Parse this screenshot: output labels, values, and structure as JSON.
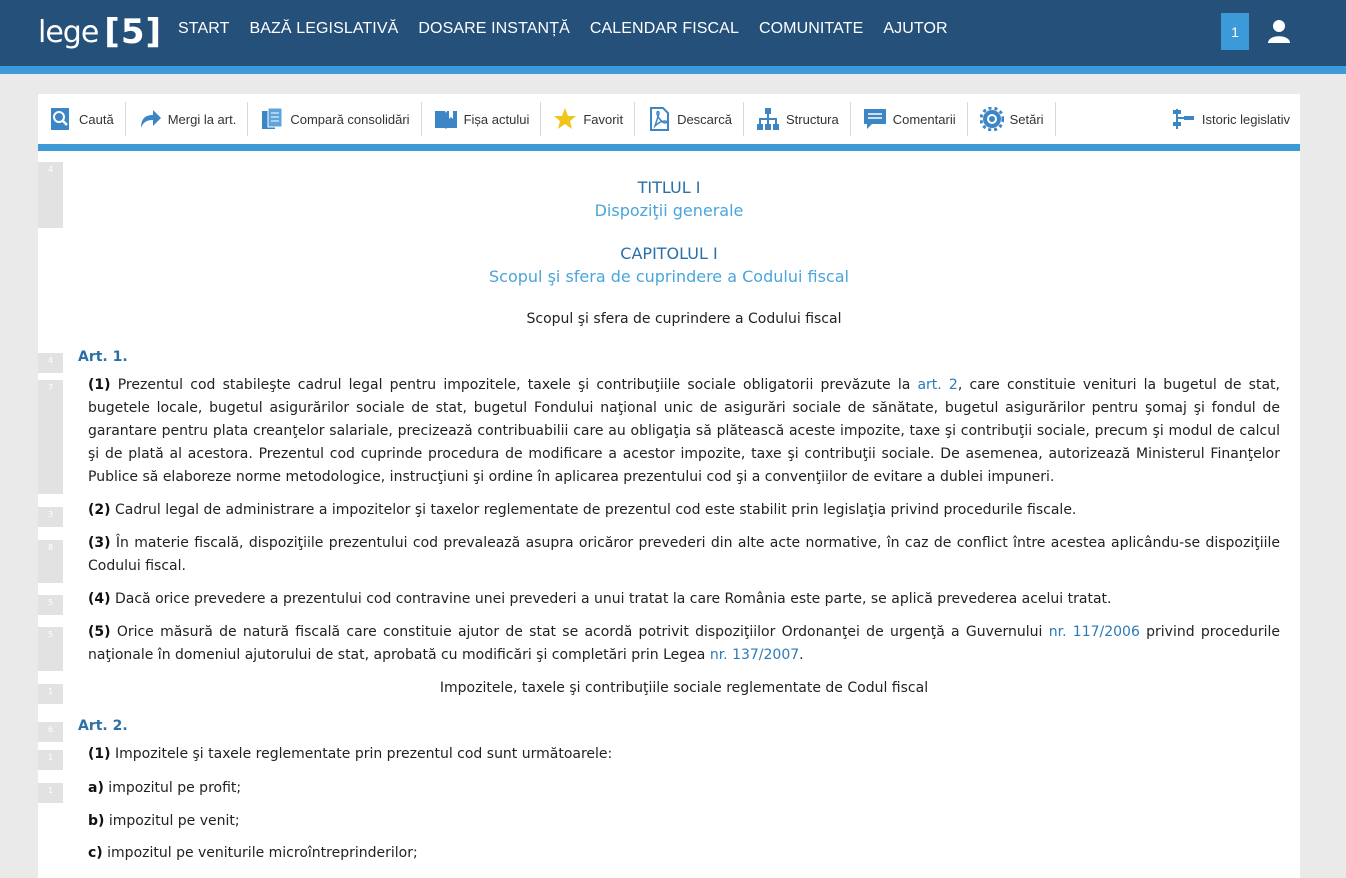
{
  "logo": {
    "word": "lege",
    "number": "[5]"
  },
  "nav": [
    "START",
    "BAZĂ LEGISLATIVĂ",
    "DOSARE INSTANȚĂ",
    "CALENDAR FISCAL",
    "COMUNITATE",
    "AJUTOR"
  ],
  "badge": "1",
  "toolbar": {
    "search": "Caută",
    "goto": "Mergi la art.",
    "compare": "Compară consolidări",
    "sheet": "Fișa actului",
    "favorite": "Favorit",
    "download": "Descarcă",
    "structure": "Structura",
    "comments": "Comentarii",
    "settings": "Setări",
    "history": "Istoric legislativ"
  },
  "doc": {
    "title1": "TITLUL I",
    "title1_sub": "Dispoziţii generale",
    "chapter1": "CAPITOLUL I",
    "chapter1_sub": "Scopul şi sfera de cuprindere a Codului fiscal",
    "marginal1": "Scopul şi sfera de cuprindere a Codului fiscal",
    "art1": "Art. 1.",
    "p1_num": "(1)",
    "p1_a": " Prezentul cod stabileşte cadrul legal pentru impozitele, taxele şi contribuţiile sociale obligatorii prevăzute la ",
    "p1_link": "art. 2",
    "p1_b": ", care constituie venituri la bugetul de stat, bugetele locale, bugetul asigurărilor sociale de stat, bugetul Fondului naţional unic de asigurări sociale de sănătate, bugetul asigurărilor pentru şomaj şi fondul de garantare pentru plata creanţelor salariale, precizează contribuabilii care au obligaţia să plătească aceste impozite, taxe şi contribuţii sociale, precum şi modul de calcul şi de plată al acestora. Prezentul cod cuprinde procedura de modificare a acestor impozite, taxe şi contribuţii sociale. De asemenea, autorizează Ministerul Finanţelor Publice să elaboreze norme metodologice, instrucţiuni şi ordine în aplicarea prezentului cod şi a convenţiilor de evitare a dublei impuneri.",
    "p2_num": "(2)",
    "p2": " Cadrul legal de administrare a impozitelor şi taxelor reglementate de prezentul cod este stabilit prin legislaţia privind procedurile fiscale.",
    "p3_num": "(3)",
    "p3": " În materie fiscală, dispoziţiile prezentului cod prevalează asupra oricăror prevederi din alte acte normative, în caz de conflict între acestea aplicându-se dispoziţiile Codului fiscal.",
    "p4_num": "(4)",
    "p4": " Dacă orice prevedere a prezentului cod contravine unei prevederi a unui tratat la care România este parte, se aplică prevederea acelui tratat.",
    "p5_num": "(5)",
    "p5_a": " Orice măsură de natură fiscală care constituie ajutor de stat se acordă potrivit dispoziţiilor Ordonanţei de urgenţă a Guvernului ",
    "p5_link1": "nr. 117/2006",
    "p5_b": " privind procedurile naţionale în domeniul ajutorului de stat, aprobată cu modificări şi completări prin Legea ",
    "p5_link2": "nr. 137/2007",
    "p5_c": ".",
    "marginal2": "Impozitele, taxele şi contribuţiile sociale reglementate de Codul fiscal",
    "art2": "Art. 2.",
    "a2p1_num": "(1)",
    "a2p1": " Impozitele şi taxele reglementate prin prezentul cod sunt următoarele:",
    "la_num": "a)",
    "la": " impozitul pe profit;",
    "lb_num": "b)",
    "lb": " impozitul pe venit;",
    "lc_num": "c)",
    "lc": " impozitul pe veniturile microîntreprinderilor;"
  },
  "gutter": [
    "4",
    "4",
    "7",
    "3",
    "8",
    "5",
    "5",
    "1",
    "6",
    "1",
    "1"
  ],
  "colors": {
    "header": "#24507a",
    "accent": "#3d9ad8",
    "title": "#2c6fa6",
    "subtitle": "#49a5dc"
  }
}
